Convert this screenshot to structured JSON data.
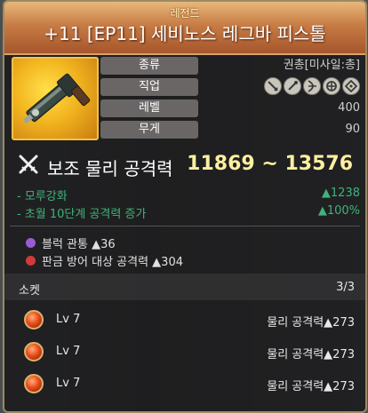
{
  "header": {
    "grade": "레전드",
    "item_name": "+11 [EP11] 세비노스 레그바 피스톨"
  },
  "attributes": [
    {
      "label": "종류",
      "value": "권총[미사일:총]"
    },
    {
      "label": "직업",
      "value": ""
    },
    {
      "label": "레벨",
      "value": "400"
    },
    {
      "label": "무게",
      "value": "90"
    }
  ],
  "class_icons": [
    "swordsman-class-icon",
    "wizard-class-icon",
    "archer-class-icon",
    "cleric-class-icon",
    "scout-class-icon"
  ],
  "main_stat": {
    "name": "보조 물리 공격력",
    "range": "11869 ~ 13576"
  },
  "bonuses": [
    {
      "label": "- 모루강화",
      "value": "▲1238"
    },
    {
      "label": "- 초월 10단계 공격력 증가",
      "value": "▲100%"
    }
  ],
  "options": [
    {
      "text": "블럭 관통 ▲36",
      "color": "#9b5bd6"
    },
    {
      "text": "판금 방어 대상 공격력 ▲304",
      "color": "#d23a3a"
    }
  ],
  "socket": {
    "title": "소켓",
    "count": "3/3",
    "gems": [
      {
        "level": "Lv 7",
        "stat": "물리 공격력▲273"
      },
      {
        "level": "Lv 7",
        "stat": "물리 공격력▲273"
      },
      {
        "level": "Lv 7",
        "stat": "물리 공격력▲273"
      }
    ]
  },
  "colors": {
    "header_top": "#e8b87a",
    "header_bottom": "#a6562c",
    "main_stat_value": "#fff0a0",
    "bonus_green": "#3fb37a",
    "border": "#9c8a66"
  }
}
